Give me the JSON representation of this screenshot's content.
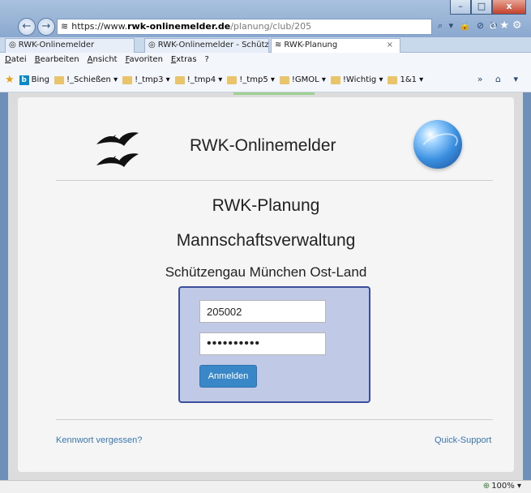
{
  "browser": {
    "address": {
      "scheme": "https://www.",
      "domain": "rwk-onlinemelder.de",
      "path": "/planung/club/205",
      "tools": "⌕ ▾ 🔒 ⊘ ↻"
    },
    "window_controls": {
      "minimize": "–",
      "maximize": "□",
      "close": "x"
    },
    "nav": {
      "back": "←",
      "forward": "→"
    },
    "right_tools": "⌂★⚙",
    "tabs": [
      {
        "label": "RWK-Onlinemelder"
      },
      {
        "label": "RWK-Onlinemelder - Schützen..."
      },
      {
        "label": "RWK-Planung",
        "close": "×"
      }
    ],
    "menu": [
      "Datei",
      "Bearbeiten",
      "Ansicht",
      "Favoriten",
      "Extras",
      "?"
    ],
    "favorites": [
      {
        "label": "Bing"
      },
      {
        "label": "!_Schießen ▾"
      },
      {
        "label": "!_tmp3 ▾"
      },
      {
        "label": "!_tmp4 ▾"
      },
      {
        "label": "!_tmp5 ▾"
      },
      {
        "label": "!GMOL ▾"
      },
      {
        "label": "!Wichtig ▾"
      },
      {
        "label": "1&1 ▾"
      }
    ],
    "fav_right": "» ⌂ ▾",
    "zoom": "100%",
    "zoom_arrow": "▾"
  },
  "page": {
    "app_title": "RWK-Onlinemelder",
    "heading1": "RWK-Planung",
    "heading2": "Mannschaftsverwaltung",
    "heading3": "Schützengau München Ost-Land",
    "login": {
      "username_value": "205002",
      "password_value": "••••••••••",
      "submit_label": "Anmelden"
    },
    "forgot_link": "Kennwort vergessen?",
    "support_link": "Quick-Support"
  },
  "colors": {
    "login_box": "#c0c9e6",
    "login_border": "#3b4f9a",
    "button": "#3a87c8",
    "link": "#3b76b1"
  }
}
